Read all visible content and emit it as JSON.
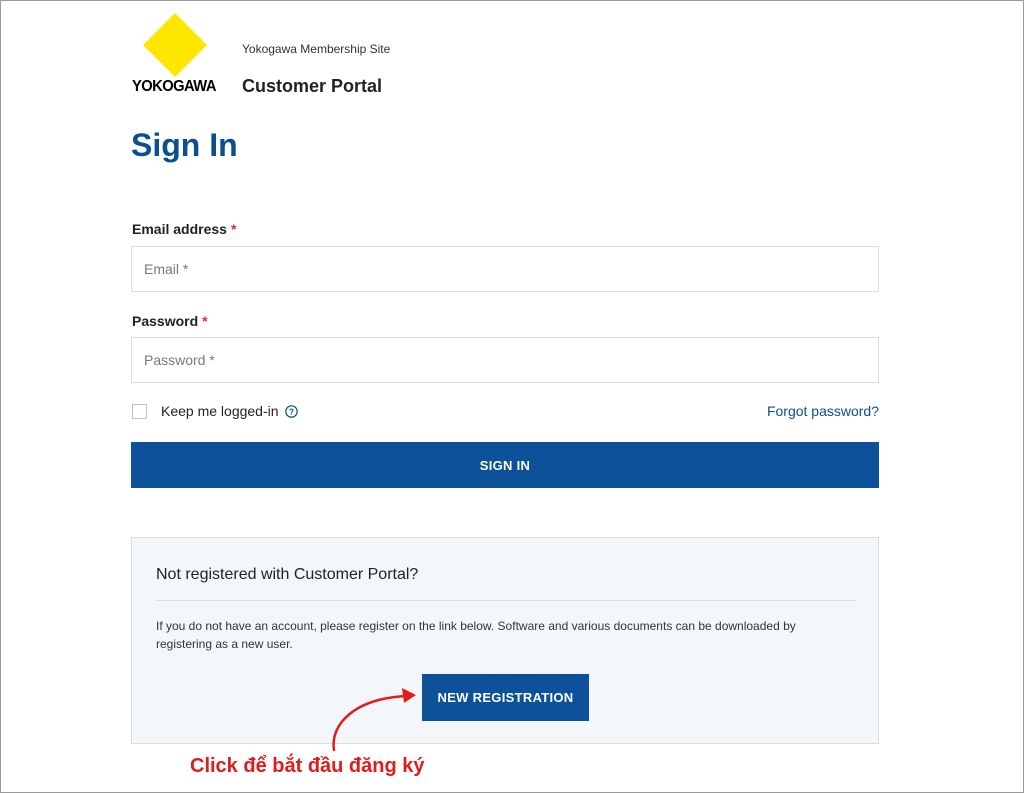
{
  "brand": {
    "logo_text": "YOKOGAWA",
    "logo_color": "#ffe600",
    "site_subtitle": "Yokogawa Membership Site",
    "site_title": "Customer Portal"
  },
  "page_title": "Sign In",
  "form": {
    "email_label": "Email address",
    "email_required_mark": "*",
    "email_placeholder": "Email *",
    "password_label": "Password",
    "password_required_mark": "*",
    "password_placeholder": "Password *",
    "keep_logged_in_label": "Keep me logged-in",
    "keep_logged_in_checked": false,
    "forgot_password_label": "Forgot password?",
    "sign_in_label": "SIGN IN"
  },
  "registration": {
    "title": "Not registered with Customer Portal?",
    "description": "If you do not have an account, please register on the link below. Software and various documents can be downloaded by registering as a new user.",
    "button_label": "NEW REGISTRATION"
  },
  "annotation": {
    "text": "Click để bắt đầu đăng ký",
    "color": "#e21b1b"
  },
  "colors": {
    "primary": "#0d519a",
    "title": "#0b4f8f",
    "required": "#d0312d"
  },
  "icons": {
    "logo": "yokogawa-diamond-icon",
    "info": "info-circle-icon",
    "annotation_arrow": "curved-arrow-icon"
  }
}
